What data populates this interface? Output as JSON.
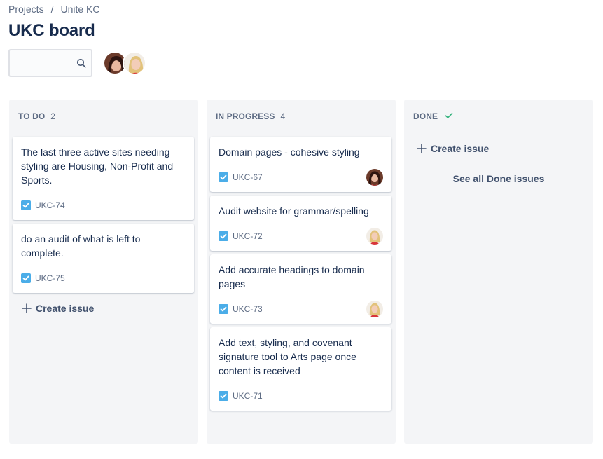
{
  "breadcrumb": {
    "projects": "Projects",
    "separator": "/",
    "project": "Unite KC"
  },
  "page_title": "UKC board",
  "search": {
    "value": "",
    "placeholder": ""
  },
  "columns": [
    {
      "name": "TO DO",
      "count": "2",
      "cards": [
        {
          "summary": "The last three active sites needing styling are Housing, Non-Profit and Sports.",
          "key": "UKC-74",
          "assignee": ""
        },
        {
          "summary": "do an audit of what is left to complete.",
          "key": "UKC-75",
          "assignee": ""
        }
      ],
      "create_label": "Create issue"
    },
    {
      "name": "IN PROGRESS",
      "count": "4",
      "cards": [
        {
          "summary": "Domain pages - cohesive styling",
          "key": "UKC-67",
          "assignee": "avatar-dark-hair"
        },
        {
          "summary": "Audit website for grammar/spelling",
          "key": "UKC-72",
          "assignee": "avatar-blonde"
        },
        {
          "summary": "Add accurate headings to domain pages",
          "key": "UKC-73",
          "assignee": "avatar-blonde"
        },
        {
          "summary": "Add text, styling, and covenant signature tool to Arts page once content is received",
          "key": "UKC-71",
          "assignee": ""
        }
      ]
    },
    {
      "name": "DONE",
      "count": "",
      "create_label": "Create issue",
      "see_all_label": "See all Done issues"
    }
  ],
  "colors": {
    "column_bg": "#f4f5f7",
    "text_primary": "#172b4d",
    "text_muted": "#5e6c84",
    "task_icon": "#4bade8",
    "done_check": "#36b37e"
  }
}
